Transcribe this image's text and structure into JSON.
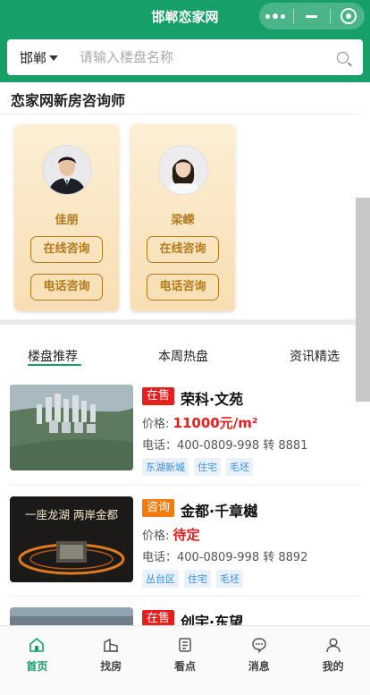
{
  "app": {
    "title": "邯郸恋家网"
  },
  "search": {
    "city": "邯郸",
    "placeholder": "请输入楼盘名称"
  },
  "consultants": {
    "title": "恋家网新房咨询师",
    "items": [
      {
        "name": "佳朋",
        "online_label": "在线咨询",
        "phone_label": "电话咨询"
      },
      {
        "name": "梁嵘",
        "online_label": "在线咨询",
        "phone_label": "电话咨询"
      }
    ]
  },
  "tabs": [
    "楼盘推荐",
    "本周热盘",
    "资讯精选"
  ],
  "listings": [
    {
      "status": "在售",
      "status_color": "#e61e1e",
      "name": "荣科·文苑",
      "price_label": "价格:",
      "price": "11000元/m²",
      "phone": "电话：400-0809-998 转 8881",
      "tags": [
        "东湖新城",
        "住宅",
        "毛坯"
      ]
    },
    {
      "status": "咨询",
      "status_color": "#f07c10",
      "name": "金都·千章樾",
      "price_label": "价格:",
      "price": "待定",
      "phone": "电话：400-0809-998 转 8892",
      "tags": [
        "丛台区",
        "住宅",
        "毛坯"
      ],
      "thumb_text": "一座龙湖 两岸金都"
    },
    {
      "status": "在售",
      "status_color": "#e61e1e",
      "name": "创宇·东望"
    }
  ],
  "nav": [
    {
      "label": "首页",
      "icon": "home-icon",
      "active": true
    },
    {
      "label": "找房",
      "icon": "buildings-icon",
      "active": false
    },
    {
      "label": "看点",
      "icon": "document-icon",
      "active": false
    },
    {
      "label": "消息",
      "icon": "message-icon",
      "active": false
    },
    {
      "label": "我的",
      "icon": "user-icon",
      "active": false
    }
  ],
  "colors": {
    "brand": "#16a067",
    "price": "#e61e1e",
    "consult": "#b27a1c"
  }
}
